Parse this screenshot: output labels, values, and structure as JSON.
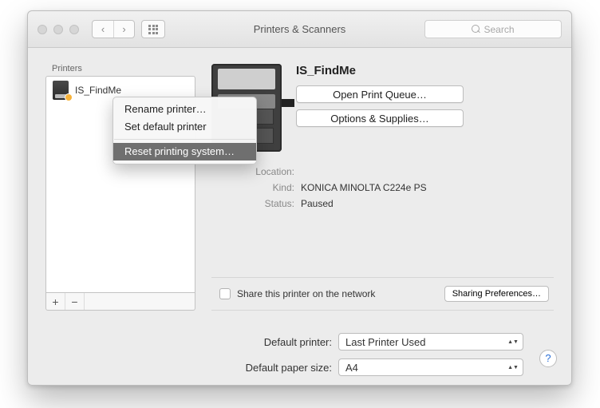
{
  "window": {
    "title": "Printers & Scanners"
  },
  "search": {
    "placeholder": "Search"
  },
  "sidebar": {
    "header": "Printers",
    "items": [
      {
        "name": "IS_FindMe",
        "status_color": "#f6b23b"
      }
    ],
    "add_glyph": "+",
    "remove_glyph": "−"
  },
  "context_menu": {
    "items": [
      {
        "label": "Rename printer…",
        "selected": false
      },
      {
        "label": "Set default printer",
        "selected": false
      }
    ],
    "items2": [
      {
        "label": "Reset printing system…",
        "selected": true
      }
    ]
  },
  "detail": {
    "name": "IS_FindMe",
    "buttons": {
      "queue": "Open Print Queue…",
      "options": "Options & Supplies…"
    },
    "meta": {
      "location_label": "Location:",
      "location_value": "",
      "kind_label": "Kind:",
      "kind_value": "KONICA MINOLTA C224e PS",
      "status_label": "Status:",
      "status_value": "Paused"
    },
    "share": {
      "label": "Share this printer on the network",
      "button": "Sharing Preferences…"
    }
  },
  "defaults": {
    "printer_label": "Default printer:",
    "printer_value": "Last Printer Used",
    "paper_label": "Default paper size:",
    "paper_value": "A4"
  },
  "help_glyph": "?"
}
